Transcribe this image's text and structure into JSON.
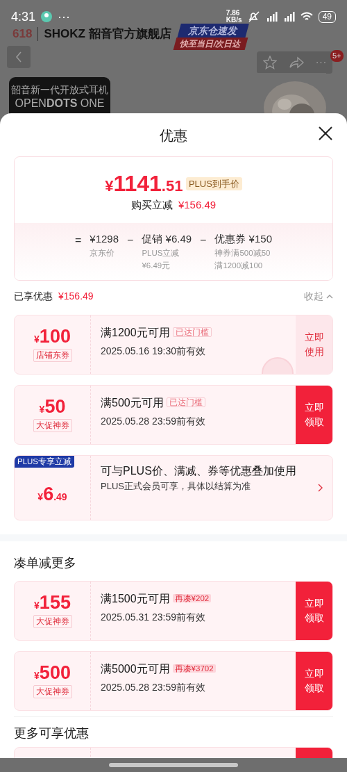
{
  "status_bar": {
    "time": "4:31",
    "menu_dots": "···",
    "speed_value": "7.86",
    "speed_unit": "KB/s",
    "battery": "49"
  },
  "store_header": {
    "logo_text": "618",
    "store_name": "SHOKZ 韶音官方旗舰店",
    "banner_top": "京东仓速发",
    "banner_bottom": "快至当日/次日达",
    "cart_badge": "5+",
    "more": "···",
    "promo_title": "韶音新一代开放式耳机",
    "promo_model": "OPEN**DOTS** ONE"
  },
  "sheet": {
    "title": "优惠"
  },
  "summary": {
    "currency": "¥",
    "price_int": "1141",
    "price_dec": ".51",
    "price_tag": "PLUS到手价",
    "saving_label": "购买立减",
    "saving_amount": "¥156.49",
    "breakdown": [
      {
        "op": "=",
        "main": "¥1298",
        "notes": [
          "京东价"
        ]
      },
      {
        "op": "−",
        "main": "促销 ¥6.49",
        "notes": [
          "PLUS立减",
          "¥6.49元"
        ]
      },
      {
        "op": "−",
        "main": "优惠券 ¥150",
        "notes": [
          "神券满500减50",
          "满1200减100"
        ]
      }
    ]
  },
  "enjoyed": {
    "label": "已享优惠",
    "amount": "¥156.49",
    "toggle": "收起",
    "expanded": true
  },
  "coupons": [
    {
      "kind": "coupon",
      "currency": "¥",
      "amount": "100",
      "type": "店铺东券",
      "condition": "满1200元可用",
      "tag": "已达门槛",
      "reached": true,
      "validity": "2025.05.16 19:30前有效",
      "action": "立即使用",
      "claimed": true
    },
    {
      "kind": "coupon",
      "currency": "¥",
      "amount": "50",
      "type": "大促神券",
      "condition": "满500元可用",
      "tag": "已达门槛",
      "reached": true,
      "validity": "2025.05.28 23:59前有效",
      "action": "立即领取",
      "claimed": false
    },
    {
      "kind": "plus",
      "badge": "PLUS专享立减",
      "currency": "¥",
      "amount": "6",
      "decimal": ".49",
      "text": "可与PLUS价、满减、券等优惠叠加使用",
      "note": "PLUS正式会员可享，具体以结算为准"
    }
  ],
  "more_section": {
    "title": "凑单减更多",
    "coupons": [
      {
        "kind": "coupon",
        "currency": "¥",
        "amount": "155",
        "type": "大促神券",
        "condition": "满1500元可用",
        "tag": "再凑¥202",
        "reached": false,
        "validity": "2025.05.31 23:59前有效",
        "action": "立即领取",
        "claimed": false
      },
      {
        "kind": "coupon",
        "currency": "¥",
        "amount": "500",
        "type": "大促神券",
        "condition": "满5000元可用",
        "tag": "再凑¥3702",
        "reached": false,
        "validity": "2025.05.28 23:59前有效",
        "action": "立即领取",
        "claimed": false
      }
    ]
  },
  "extra_section": {
    "title": "更多可享优惠"
  }
}
